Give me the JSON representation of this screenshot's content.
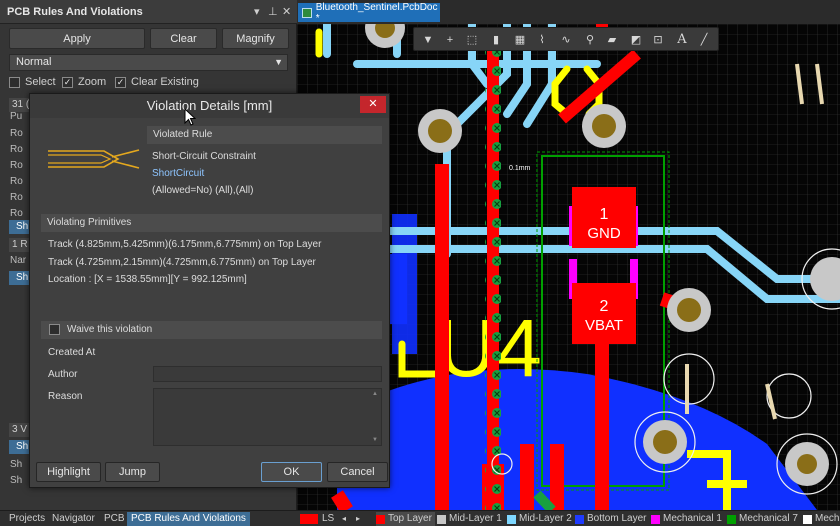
{
  "panel": {
    "title": "PCB Rules And Violations",
    "pin_icon": "▾",
    "dock_icon": "⊥",
    "close_icon": "✕",
    "buttons": {
      "apply": "Apply",
      "clear": "Clear",
      "magnify": "Magnify"
    },
    "filter_value": "Normal",
    "checkboxes": [
      {
        "label": "Select",
        "checked": false
      },
      {
        "label": "Zoom",
        "checked": true
      },
      {
        "label": "Clear Existing",
        "checked": true
      }
    ],
    "fragments": {
      "rules_head": "31 (",
      "rows": [
        "Pu",
        "Ro",
        "Ro",
        "Ro",
        "Ro",
        "Ro",
        "Ro"
      ],
      "sel_row": "Sh",
      "viol_head": "1 R",
      "viol_col": "Nar",
      "viol_sel": "Sh",
      "sub_head": "3 V",
      "sub_rows": [
        "Sh",
        "Sh",
        "Sh"
      ]
    }
  },
  "document_tab": {
    "title": "Bluetooth_Sentinel.PcbDoc *"
  },
  "dialog": {
    "title": "Violation Details [mm]",
    "violated_rule_header": "Violated Rule",
    "rule_type": "Short-Circuit Constraint",
    "rule_name": "ShortCircuit",
    "rule_scope": "(Allowed=No) (All),(All)",
    "primitives_header": "Violating Primitives",
    "primitives": [
      "Track (4.825mm,5.425mm)(6.175mm,6.775mm) on Top Layer",
      "Track (4.725mm,2.15mm)(4.725mm,6.775mm) on Top Layer",
      "Location : [X = 1538.55mm][Y = 992.125mm]"
    ],
    "waive_label": "Waive this violation",
    "created_at_label": "Created At",
    "author_label": "Author",
    "reason_label": "Reason",
    "buttons": {
      "highlight": "Highlight",
      "jump": "Jump",
      "ok": "OK",
      "cancel": "Cancel"
    }
  },
  "pcb": {
    "pad1_number": "1",
    "pad1_net": "GND",
    "pad2_number": "2",
    "pad2_net": "VBAT",
    "designator": "U4",
    "dim_label": "0.1mm"
  },
  "bottom_tabs": [
    "Projects",
    "Navigator",
    "PCB",
    "PCB Rules And Violations"
  ],
  "layer_indicator": "LS",
  "layers": [
    {
      "name": "Top Layer",
      "color": "#ff0000"
    },
    {
      "name": "Mid-Layer 1",
      "color": "#c8c8c8"
    },
    {
      "name": "Mid-Layer 2",
      "color": "#7ed7ff"
    },
    {
      "name": "Bottom Layer",
      "color": "#1f3bff"
    },
    {
      "name": "Mechanical 1",
      "color": "#ff00ff"
    },
    {
      "name": "Mechanical 7",
      "color": "#00a000"
    },
    {
      "name": "Mech",
      "color": "#ffffff"
    }
  ],
  "colors": {
    "top_layer": "#ff0000",
    "bottom_layer": "#1030ff",
    "mid_layer": "#87d5f7",
    "silk": "#ffff00",
    "accent_blue": "#3d6d95",
    "close_red": "#c4262c"
  }
}
